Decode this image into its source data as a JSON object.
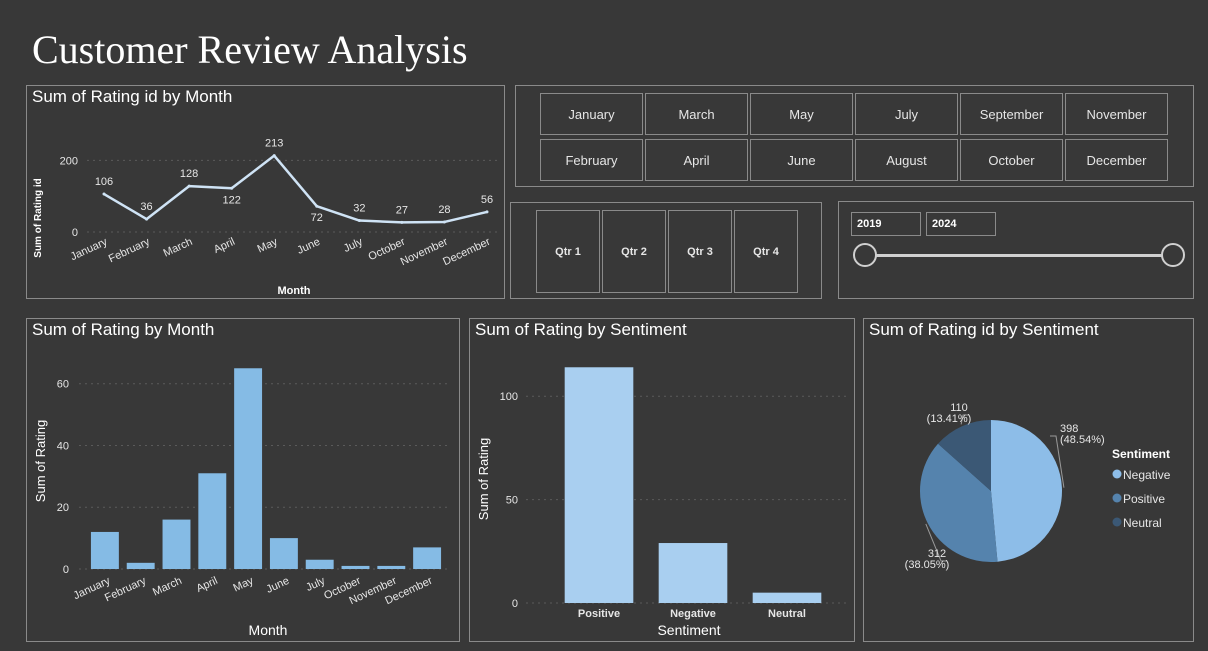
{
  "page": {
    "title": "Customer Review Analysis"
  },
  "months_slicer": {
    "row1": [
      "January",
      "March",
      "May",
      "July",
      "September",
      "November"
    ],
    "row2": [
      "February",
      "April",
      "June",
      "August",
      "October",
      "December"
    ]
  },
  "quarter_slicer": {
    "items": [
      "Qtr 1",
      "Qtr 2",
      "Qtr 3",
      "Qtr 4"
    ]
  },
  "year_slicer": {
    "start": "2019",
    "end": "2024"
  },
  "chart_data": [
    {
      "id": "line",
      "type": "line",
      "title": "Sum of Rating id by Month",
      "xlabel": "Month",
      "ylabel": "Sum of Rating id",
      "categories": [
        "January",
        "February",
        "March",
        "April",
        "May",
        "June",
        "July",
        "October",
        "November",
        "December"
      ],
      "values": [
        106,
        36,
        128,
        122,
        213,
        72,
        32,
        27,
        28,
        56
      ],
      "yticks": [
        0,
        200
      ],
      "ylim": [
        0,
        240
      ],
      "grid": true,
      "color": "#cfe3f5"
    },
    {
      "id": "bar_month",
      "type": "bar",
      "title": "Sum of Rating by Month",
      "xlabel": "Month",
      "ylabel": "Sum of Rating",
      "categories": [
        "January",
        "February",
        "March",
        "April",
        "May",
        "June",
        "July",
        "October",
        "November",
        "December"
      ],
      "values": [
        12,
        2,
        16,
        31,
        65,
        10,
        3,
        1,
        1,
        7
      ],
      "yticks": [
        0,
        20,
        40,
        60
      ],
      "ylim": [
        0,
        68
      ],
      "grid": true,
      "color": "#85bbe5"
    },
    {
      "id": "bar_sentiment",
      "type": "bar",
      "title": "Sum of Rating by Sentiment",
      "xlabel": "Sentiment",
      "ylabel": "Sum of Rating",
      "categories": [
        "Positive",
        "Negative",
        "Neutral"
      ],
      "values": [
        114,
        29,
        5
      ],
      "yticks": [
        0,
        50,
        100
      ],
      "ylim": [
        0,
        118
      ],
      "grid": true,
      "color": "#a9cff0"
    },
    {
      "id": "pie",
      "type": "pie",
      "title": "Sum of Rating id by Sentiment",
      "legend_title": "Sentiment",
      "legend_position": "right",
      "slices": [
        {
          "name": "Negative",
          "value": 398,
          "label": "398",
          "pct": "(48.54%)",
          "color": "#8dbde8"
        },
        {
          "name": "Positive",
          "value": 312,
          "label": "312",
          "pct": "(38.05%)",
          "color": "#5583ad"
        },
        {
          "name": "Neutral",
          "value": 110,
          "label": "110",
          "pct": "(13.41%)",
          "color": "#3b5875"
        }
      ]
    }
  ]
}
